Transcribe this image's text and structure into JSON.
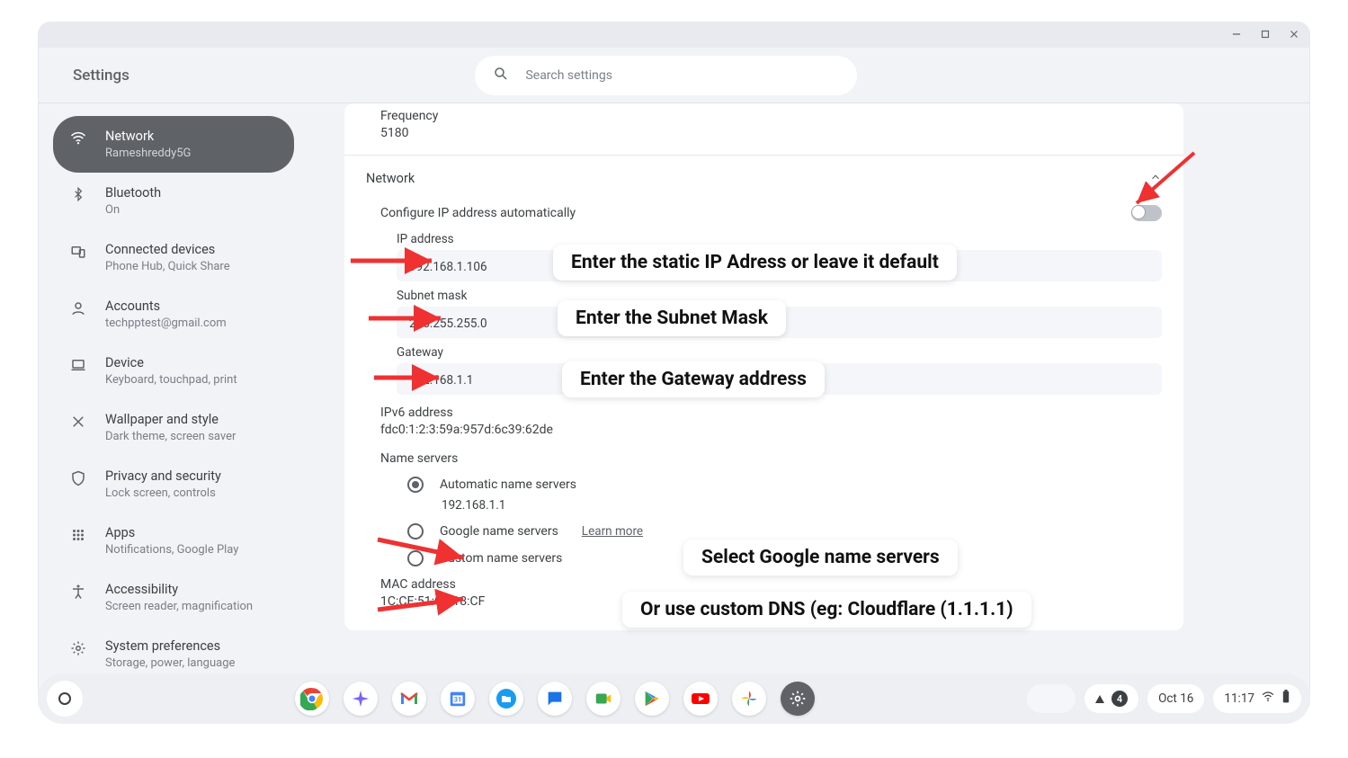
{
  "window": {
    "app_title": "Settings"
  },
  "search": {
    "placeholder": "Search settings"
  },
  "sidebar": {
    "items": [
      {
        "title": "Network",
        "sub": "Rameshreddy5G"
      },
      {
        "title": "Bluetooth",
        "sub": "On"
      },
      {
        "title": "Connected devices",
        "sub": "Phone Hub, Quick Share"
      },
      {
        "title": "Accounts",
        "sub": "techpptest@gmail.com"
      },
      {
        "title": "Device",
        "sub": "Keyboard, touchpad, print"
      },
      {
        "title": "Wallpaper and style",
        "sub": "Dark theme, screen saver"
      },
      {
        "title": "Privacy and security",
        "sub": "Lock screen, controls"
      },
      {
        "title": "Apps",
        "sub": "Notifications, Google Play"
      },
      {
        "title": "Accessibility",
        "sub": "Screen reader, magnification"
      },
      {
        "title": "System preferences",
        "sub": "Storage, power, language"
      }
    ]
  },
  "main": {
    "frequency_label": "Frequency",
    "frequency_value": "5180",
    "section_title": "Network",
    "auto_ip_label": "Configure IP address automatically",
    "ip_label": "IP address",
    "ip_value": "192.168.1.106",
    "subnet_label": "Subnet mask",
    "subnet_value": "255.255.255.0",
    "gateway_label": "Gateway",
    "gateway_value": "192.168.1.1",
    "ipv6_label": "IPv6 address",
    "ipv6_value": "fdc0:1:2:3:59a:957d:6c39:62de",
    "ns_label": "Name servers",
    "ns_auto": "Automatic name servers",
    "ns_auto_value": "192.168.1.1",
    "ns_google": "Google name servers",
    "ns_google_learn": "Learn more",
    "ns_custom": "Custom name servers",
    "mac_label": "MAC address",
    "mac_value": "1C:CE:51:C3:18:CF"
  },
  "callouts": {
    "c1": "Enter the static IP Adress or leave it default",
    "c2": "Enter the Subnet Mask",
    "c3": "Enter the Gateway address",
    "c4": "Select Google name servers",
    "c5": "Or use custom DNS (eg: Cloudflare (1.1.1.1)"
  },
  "shelf": {
    "date": "Oct 16",
    "time": "11:17",
    "notif_count": "4"
  }
}
